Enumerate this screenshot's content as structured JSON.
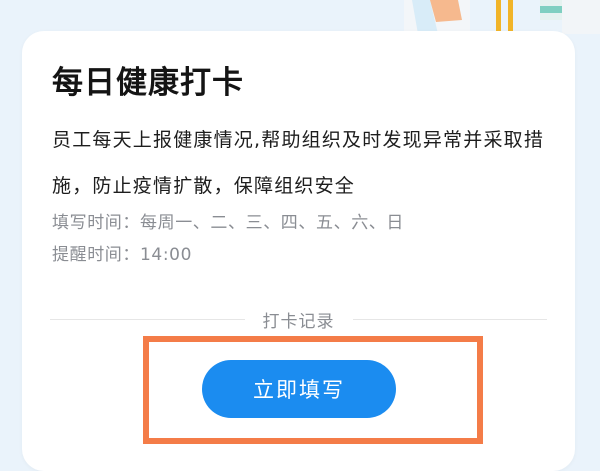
{
  "card": {
    "title": "每日健康打卡",
    "description": "员工每天上报健康情况,帮助组织及时发现异常并采取措施，防止疫情扩散，保障组织安全",
    "fill_time": "填写时间：每周一、二、三、四、五、六、日",
    "remind_time": "提醒时间：14:00",
    "records_link": "打卡记录",
    "fill_button": "立即填写"
  },
  "colors": {
    "accent": "#1b8cf0",
    "highlight_border": "#f47c48",
    "page_background": "#eaf3fb",
    "meta_text": "#8a8d93"
  }
}
